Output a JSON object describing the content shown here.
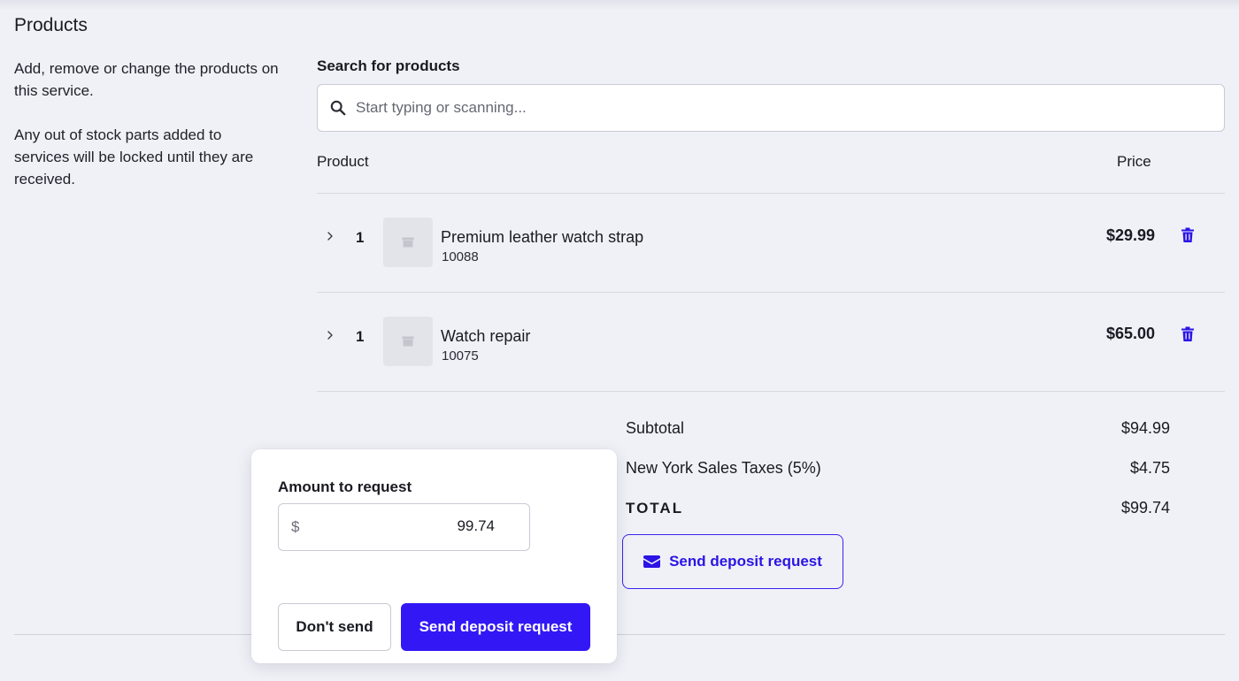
{
  "section": {
    "title": "Products",
    "description_1": "Add, remove or change the products on this service.",
    "description_2": "Any out of stock parts added to services will be locked until they are received."
  },
  "search": {
    "label": "Search for products",
    "placeholder": "Start typing or scanning...",
    "icon": "search-icon"
  },
  "table": {
    "columns": [
      "Product",
      "Price"
    ],
    "rows": [
      {
        "qty": "1",
        "name": "Premium leather watch strap",
        "sku": "10088",
        "price": "$29.99"
      },
      {
        "qty": "1",
        "name": "Watch repair",
        "sku": "10075",
        "price": "$65.00"
      }
    ]
  },
  "summary": {
    "subtotal_label": "Subtotal",
    "subtotal_value": "$94.99",
    "tax_label": "New York Sales Taxes (5%)",
    "tax_value": "$4.75",
    "total_label": "TOTAL",
    "total_value": "$99.74",
    "deposit_button": "Send deposit request"
  },
  "popover": {
    "amount_label": "Amount to request",
    "currency": "$",
    "amount_value": "99.74",
    "dont_send": "Don't send",
    "send": "Send deposit request"
  },
  "colors": {
    "accent": "#3318f5",
    "background": "#f0f1f7"
  }
}
